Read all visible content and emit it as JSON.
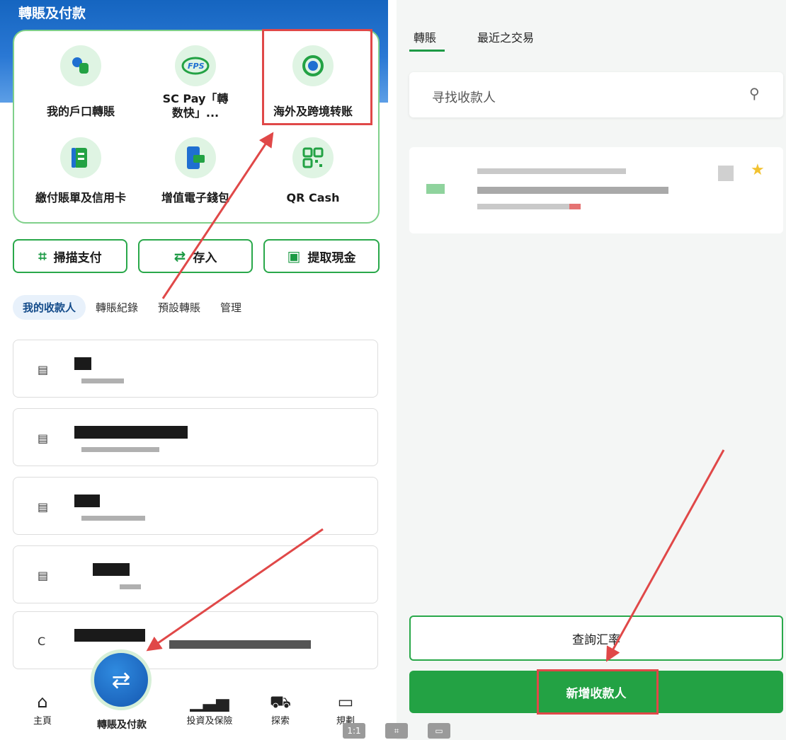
{
  "left": {
    "section_title": "轉賬及付款",
    "services": [
      {
        "label": "我的戶口轉賬",
        "icon": "account-transfer-icon"
      },
      {
        "label": "SC Pay「轉\n数快」...",
        "icon": "fps-icon"
      },
      {
        "label": "海外及跨境转账",
        "icon": "overseas-transfer-icon"
      },
      {
        "label": "繳付賬單及信用卡",
        "icon": "bill-icon"
      },
      {
        "label": "增值電子錢包",
        "icon": "ewallet-icon"
      },
      {
        "label": "QR Cash",
        "icon": "qr-icon"
      }
    ],
    "actions": [
      {
        "label": "掃描支付",
        "icon": "scan-icon"
      },
      {
        "label": "存入",
        "icon": "deposit-icon"
      },
      {
        "label": "提取現金",
        "icon": "withdraw-icon"
      }
    ],
    "tabs": [
      "我的收款人",
      "轉賬紀錄",
      "預設轉賬",
      "管理"
    ],
    "payees": [
      {
        "initial": ""
      },
      {
        "initial": ""
      },
      {
        "initial": ""
      },
      {
        "initial": ""
      },
      {
        "initial": "C"
      }
    ],
    "nav": [
      "主頁",
      "轉賬及付款",
      "投資及保險",
      "探索",
      "規劃"
    ]
  },
  "right": {
    "tabs": [
      "轉賬",
      "最近之交易"
    ],
    "search_placeholder": "寻找收款人",
    "rate_button": "查詢汇率",
    "add_button": "新增收款人"
  },
  "colors": {
    "accent_green": "#23a244",
    "highlight_red": "#e04848",
    "header_blue": "#1565c0"
  }
}
